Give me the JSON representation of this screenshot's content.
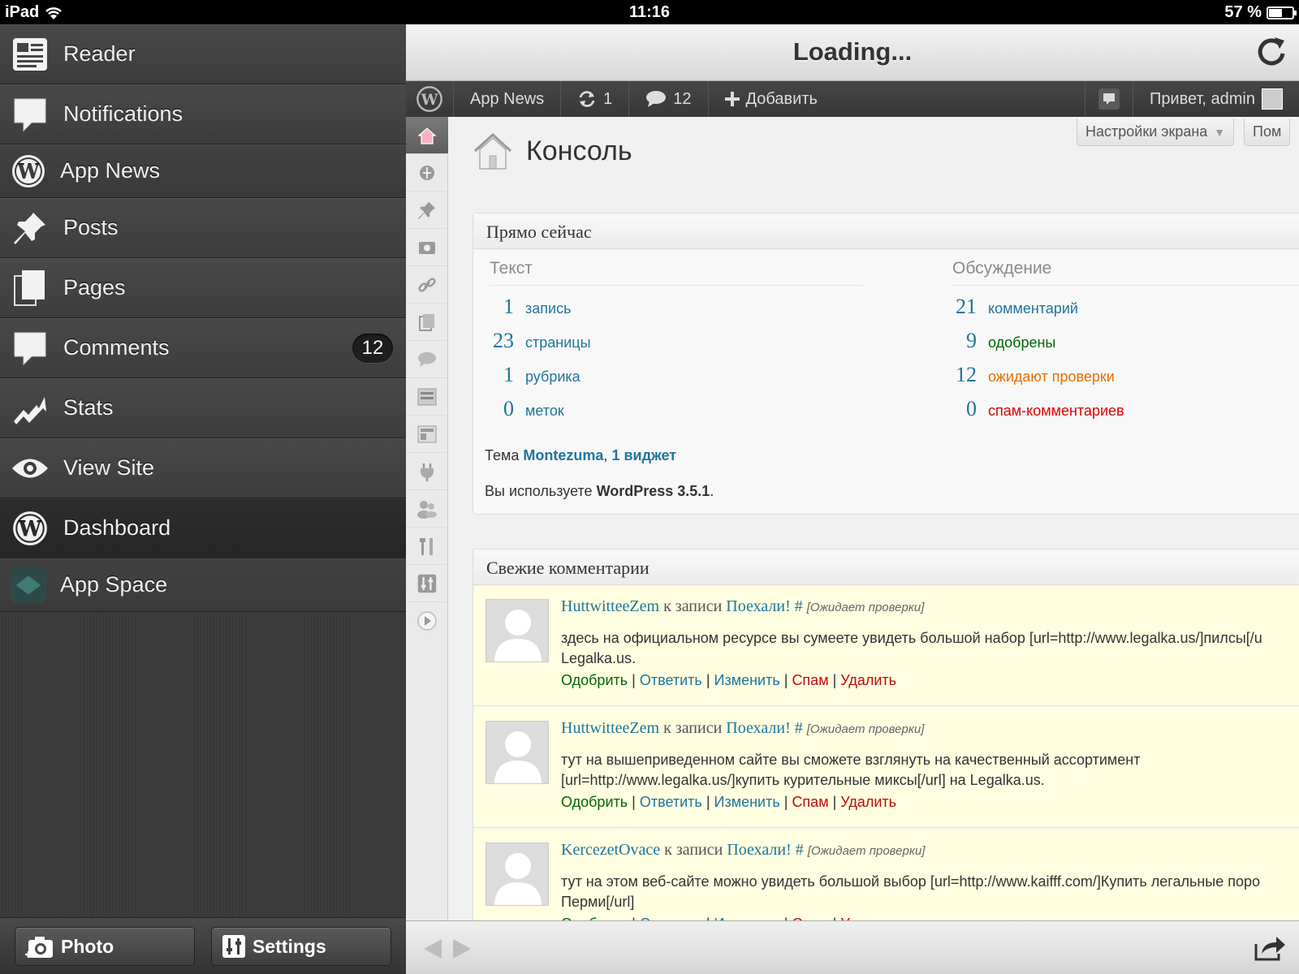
{
  "status_bar": {
    "device": "iPad",
    "time": "11:16",
    "battery": "57 %",
    "battery_level": 0.57
  },
  "sidebar": {
    "items": [
      {
        "label": "Reader",
        "icon": "reader-icon"
      },
      {
        "label": "Notifications",
        "icon": "speech-bubble-icon"
      },
      {
        "label": "App News",
        "icon": "wordpress-icon"
      },
      {
        "label": "Posts",
        "icon": "pushpin-icon"
      },
      {
        "label": "Pages",
        "icon": "pages-icon"
      },
      {
        "label": "Comments",
        "icon": "speech-bubble-icon",
        "badge": "12"
      },
      {
        "label": "Stats",
        "icon": "stats-icon"
      },
      {
        "label": "View Site",
        "icon": "eye-icon"
      },
      {
        "label": "Dashboard",
        "icon": "wordpress-icon",
        "selected": true
      },
      {
        "label": "App Space",
        "icon": "app-space-icon"
      }
    ],
    "photo_button": "Photo",
    "settings_button": "Settings"
  },
  "navbar": {
    "title": "Loading..."
  },
  "adminbar": {
    "site": "App News",
    "updates": "1",
    "comments": "12",
    "add": "Добавить",
    "greeting": "Привет, admin"
  },
  "screen_options": {
    "settings": "Настройки экрана",
    "help": "Пом"
  },
  "page": {
    "title": "Консоль"
  },
  "right_now": {
    "title": "Прямо сейчас",
    "content_heading": "Текст",
    "discussion_heading": "Обсуждение",
    "content": [
      {
        "num": "1",
        "label": "запись"
      },
      {
        "num": "23",
        "label": "страницы"
      },
      {
        "num": "1",
        "label": "рубрика"
      },
      {
        "num": "0",
        "label": "меток"
      }
    ],
    "discussion": [
      {
        "num": "21",
        "label": "комментарий",
        "color": "#21759b"
      },
      {
        "num": "9",
        "label": "одобрены",
        "color": "#006505"
      },
      {
        "num": "12",
        "label": "ожидают проверки",
        "color": "#e66f00"
      },
      {
        "num": "0",
        "label": "спам-комментариев",
        "color": "#e00000"
      }
    ],
    "theme_prefix": "Тема",
    "theme_name": "Montezuma",
    "theme_sep": ",",
    "widgets": "1 виджет",
    "version_prefix": "Вы используете",
    "version": "WordPress 3.5.1",
    "version_suffix": "."
  },
  "recent_comments": {
    "title": "Свежие комментарии",
    "on_post": "к записи",
    "hash": "#",
    "pending": "[Ожидает проверки]",
    "actions": {
      "approve": "Одобрить",
      "reply": "Ответить",
      "edit": "Изменить",
      "spam": "Спам",
      "delete": "Удалить",
      "sep": "|"
    },
    "items": [
      {
        "author": "HuttwitteeZem",
        "post": "Поехали!",
        "line1": "здесь на официальном ресурсе вы сумеете увидеть большой набор [url=http://www.legalka.us/]пилсы[/u",
        "line2": "Legalka.us."
      },
      {
        "author": "HuttwitteeZem",
        "post": "Поехали!",
        "line1": "тут на вышеприведенном сайте вы сможете взглянуть на качественный ассортимент",
        "line2": "[url=http://www.legalka.us/]купить курительные миксы[/url] на Legalka.us."
      },
      {
        "author": "KercezetOvace",
        "post": "Поехали!",
        "line1": "тут на этом веб-сайте можно увидеть большой выбор [url=http://www.kaifff.com/]Купить легальные поро",
        "line2": "Перми[/url]"
      }
    ]
  }
}
